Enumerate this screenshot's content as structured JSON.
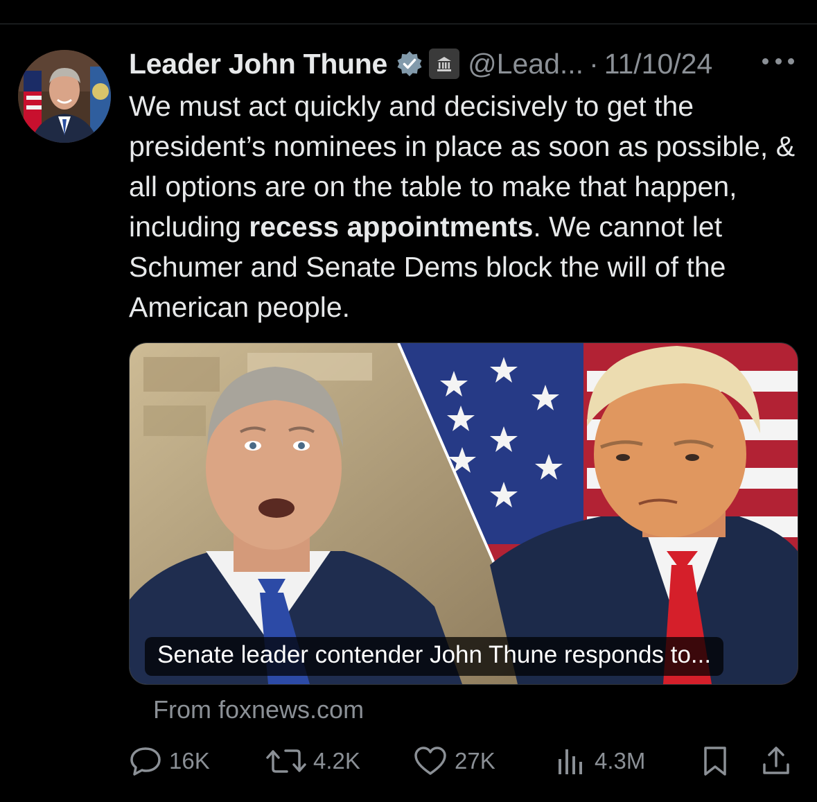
{
  "tweet": {
    "author_name": "Leader John Thune",
    "handle": "@Lead...",
    "separator": "·",
    "date": "11/10/24",
    "text_part1": "We must act quickly and decisively to get the president’s nominees in place as soon as possible, & all options are on the table to make that happen, including ",
    "text_bold": "recess appointments",
    "text_part2": ". We cannot let Schumer and Senate Dems block the will of the American people."
  },
  "card": {
    "title": "Senate leader contender John Thune responds to...",
    "source": "From foxnews.com"
  },
  "actions": {
    "replies": "16K",
    "reposts": "4.2K",
    "likes": "27K",
    "views": "4.3M"
  },
  "icons": {
    "verified": "verified-badge-icon",
    "government": "government-building-icon",
    "more": "more-dots-icon",
    "reply": "reply-icon",
    "repost": "repost-icon",
    "like": "heart-icon",
    "views": "views-bar-icon",
    "bookmark": "bookmark-icon",
    "share": "share-icon"
  },
  "colors": {
    "background": "#000000",
    "text": "#e7e9ea",
    "secondary": "#8b9096",
    "verified": "#829aab"
  }
}
